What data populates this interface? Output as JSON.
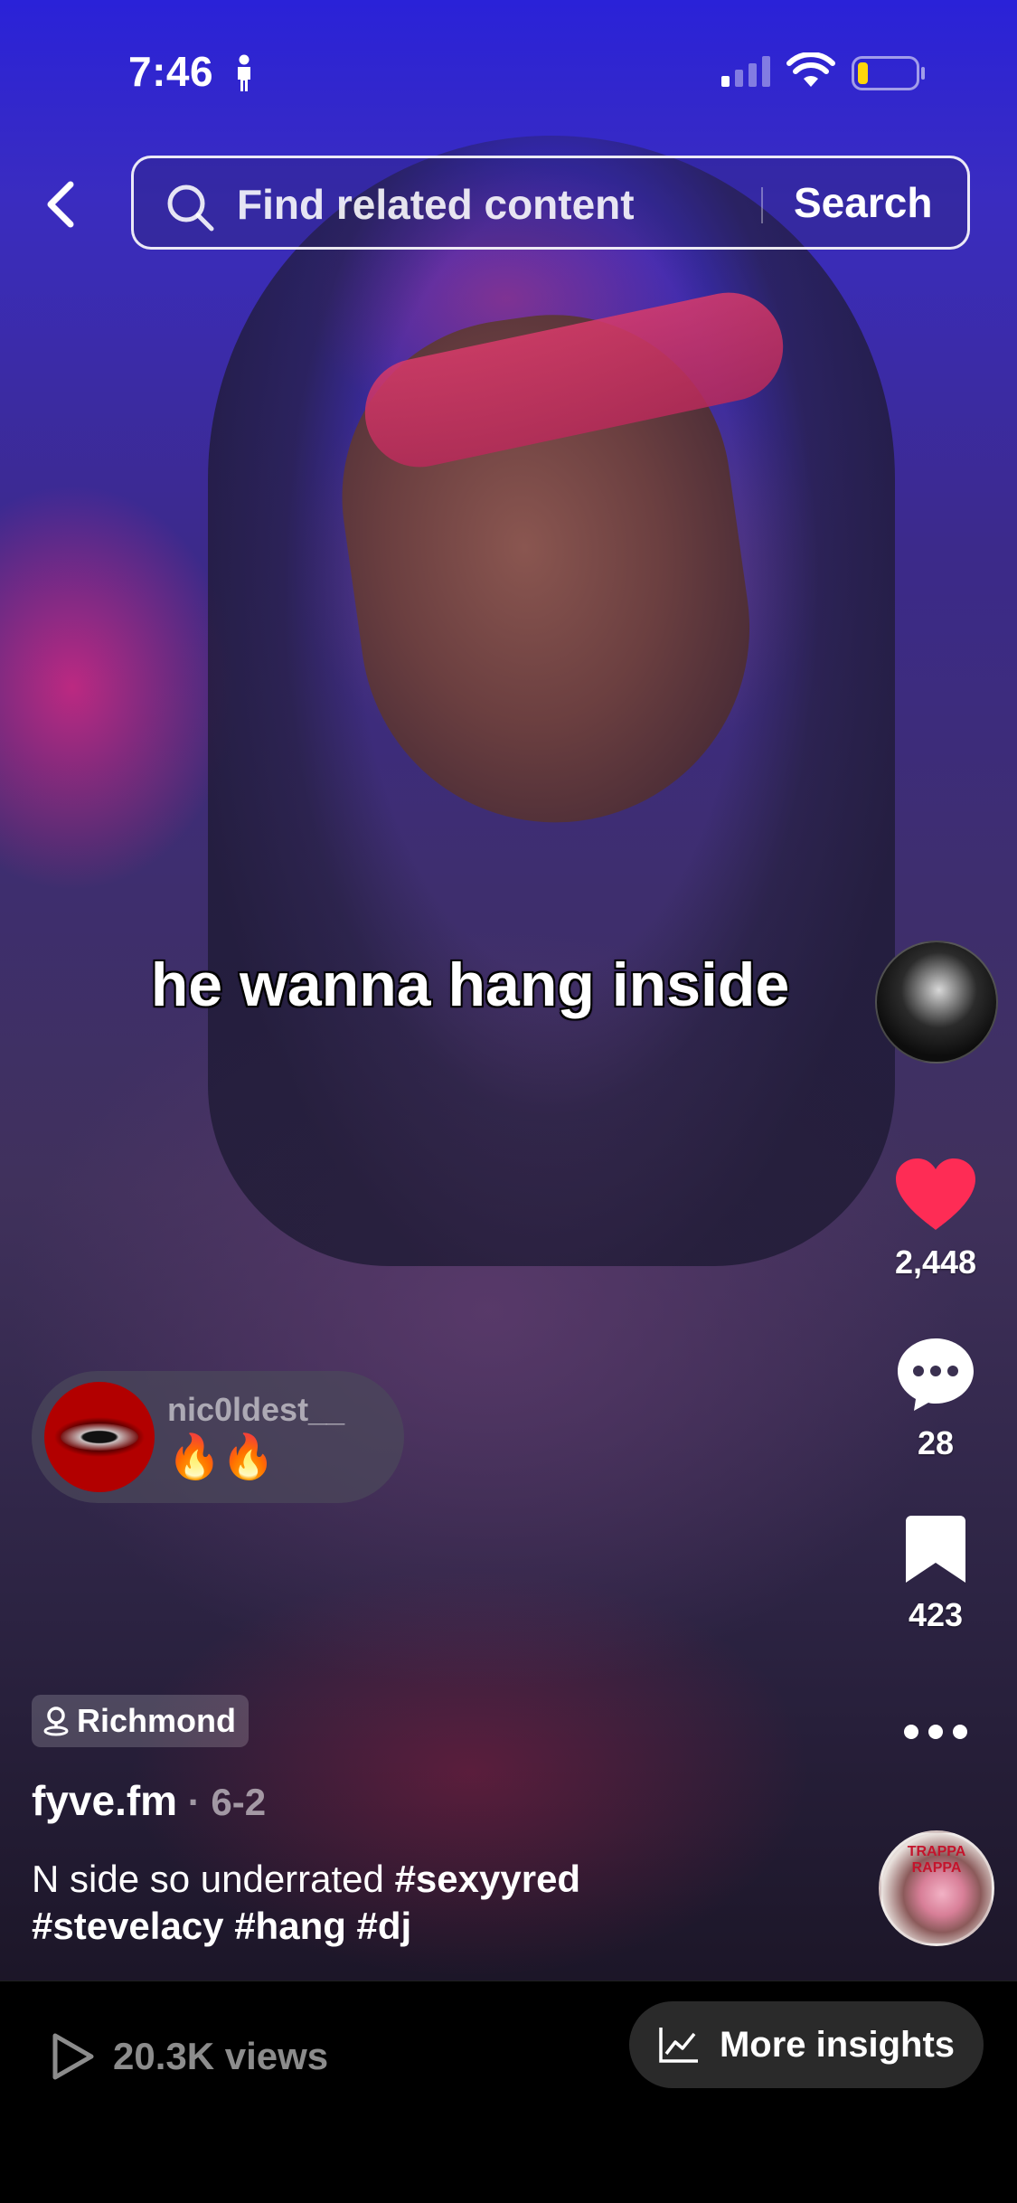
{
  "status_bar": {
    "time": "7:46"
  },
  "search": {
    "placeholder": "Find related content",
    "button_label": "Search"
  },
  "video": {
    "caption": "he wanna hang inside"
  },
  "actions": {
    "likes": "2,448",
    "comments": "28",
    "saves": "423"
  },
  "sound": {
    "disc_text": "TRAPPA RAPPA"
  },
  "comment_preview": {
    "username": "nic0ldest__",
    "text": "🔥🔥"
  },
  "post": {
    "location": "Richmond",
    "author": "fyve.fm",
    "date": " · 6-2",
    "description_text": "N side so underrated ",
    "hashtags_line1": "#sexyyred",
    "hashtags_line2": "#stevelacy #hang #dj"
  },
  "bottom_bar": {
    "views": "20.3K views",
    "insights_label": "More insights"
  },
  "colors": {
    "like_red": "#fe2c55",
    "accent_blue": "#2a22d8"
  },
  "icons": [
    "person-icon",
    "signal-icon",
    "wifi-icon",
    "battery-icon",
    "back-chevron-icon",
    "search-icon",
    "heart-icon",
    "comment-icon",
    "bookmark-icon",
    "more-dots-icon",
    "location-pin-icon",
    "play-icon",
    "chart-icon"
  ]
}
